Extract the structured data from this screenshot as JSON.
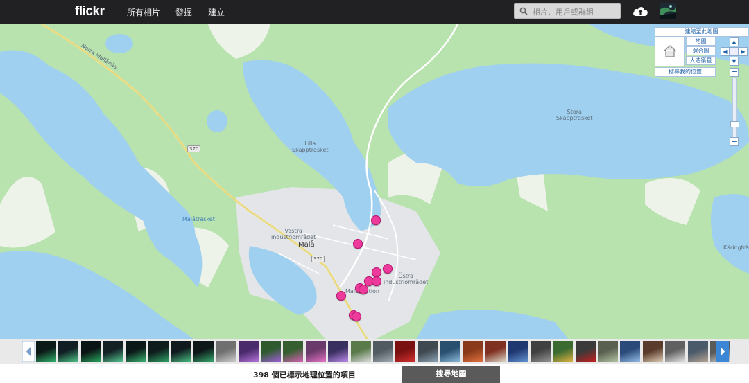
{
  "header": {
    "logo": "flickr",
    "nav": [
      "所有相片",
      "發掘",
      "建立"
    ],
    "search_placeholder": "相片、用戶或群組"
  },
  "map": {
    "labels": {
      "road": "Norra Mallånäs",
      "lilla_name": "Lilla",
      "lilla_sub": "Skäpptrasket",
      "stora_name": "Stora",
      "stora_sub": "Skäpptrasket",
      "malatrask": "Malåträsket",
      "vastra_1": "Västra",
      "vastra_2": "industriområdet",
      "town": "Malå",
      "ostra_1": "Östra",
      "ostra_2": "industriområdet",
      "station": "Malå station",
      "karing": "Käringträsk",
      "sign_370a": "370",
      "sign_370b": "370"
    },
    "controls": {
      "link_map": "連結至此地圖",
      "map_type": "地圖",
      "hybrid": "混合圖",
      "satellite": "人造衛星",
      "find_location": "搜尋我的位置"
    },
    "accent": "#1b5fa8",
    "pin_color": "#ec3b9a"
  },
  "bottom": {
    "count_text": "398 個已標示地理位置的項目",
    "search_map": "搜尋地圖"
  }
}
